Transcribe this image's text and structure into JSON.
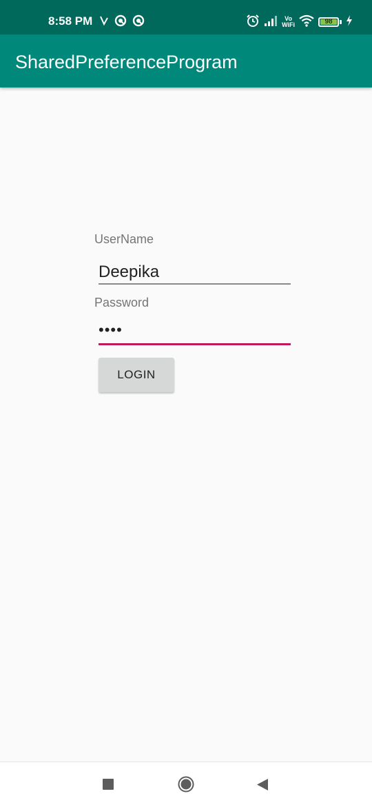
{
  "status_bar": {
    "time": "8:58 PM",
    "left_icons": [
      "signal-slash-icon",
      "notification-circle-icon",
      "notification-circle-icon"
    ],
    "right_icons": [
      "alarm-icon",
      "cell-signal-icon",
      "vowifi-icon",
      "wifi-icon",
      "battery-icon",
      "charging-bolt-icon"
    ],
    "vowifi_top": "Vo",
    "vowifi_bottom": "WiFi",
    "battery_level": "98",
    "color": "#00695c"
  },
  "app_bar": {
    "title": "SharedPreferenceProgram",
    "color": "#00897b"
  },
  "login_form": {
    "username_label": "UserName",
    "username_value": "Deepika",
    "password_label": "Password",
    "password_value": "••••",
    "login_button_label": "LOGIN",
    "focus_color": "#c2185b"
  },
  "nav_bar": {
    "icons": [
      "recents-square-icon",
      "home-circle-icon",
      "back-triangle-icon"
    ]
  }
}
